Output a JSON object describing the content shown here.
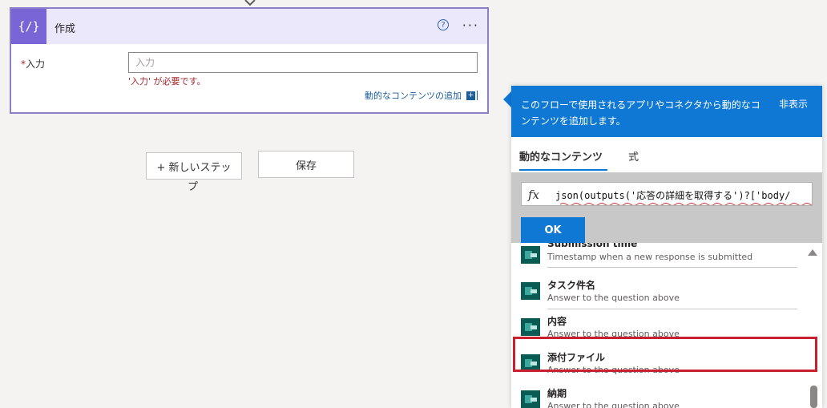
{
  "compose": {
    "title": "作成",
    "icon": "{∕}",
    "help_glyph": "?",
    "more_glyph": "···",
    "field": {
      "required_mark": "*",
      "label": "入力",
      "placeholder": "入力",
      "value": "",
      "error": "'入力' が必要です。"
    },
    "add_dynamic_label": "動的なコンテンツの追加",
    "add_dynamic_glyph": "+"
  },
  "buttons": {
    "new_step_main": "+ 新しいステッ",
    "new_step_overflow": "プ",
    "save": "保存"
  },
  "panel": {
    "description": "このフローで使用されるアプリやコネクタから動的なコンテンツを追加します。",
    "hide": "非表示",
    "tabs": [
      "動的なコンテンツ",
      "式"
    ],
    "active_tab": 0,
    "fx_glyph": "fx",
    "expression": "json(outputs('応答の詳細を取得する')?['body/",
    "ok": "OK",
    "items": [
      {
        "name": "Submission time",
        "sub": "Timestamp when a new response is submitted"
      },
      {
        "name": "タスク件名",
        "sub": "Answer to the question above"
      },
      {
        "name": "内容",
        "sub": "Answer to the question above"
      },
      {
        "name": "添付ファイル",
        "sub": "Answer to the question above"
      },
      {
        "name": "納期",
        "sub": "Answer to the question above"
      }
    ],
    "highlighted_item": 3
  },
  "colors": {
    "accent": "#0f78d4",
    "action_purple": "#7a65d6",
    "error": "#a4262c",
    "highlight": "#c8202f"
  }
}
